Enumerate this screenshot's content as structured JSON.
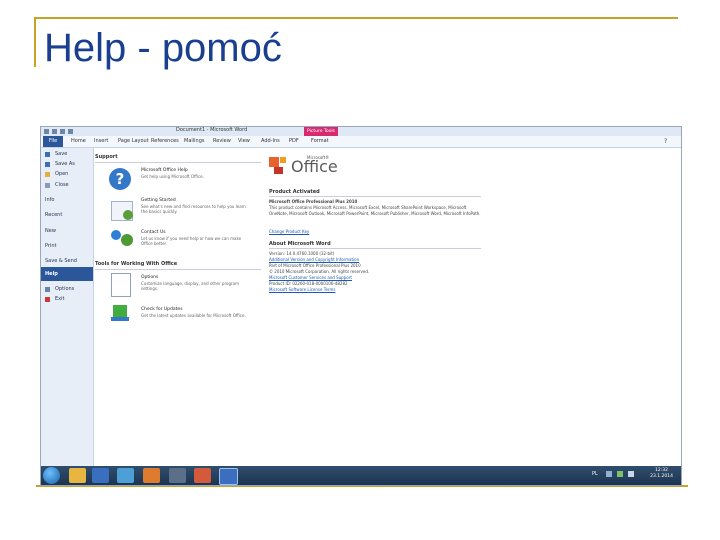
{
  "slide": {
    "title": "Help - pomoć"
  },
  "window": {
    "title": "Document1 - Microsoft Word",
    "context_tab": "Picture Tools",
    "controls": [
      "–",
      "□",
      "×"
    ]
  },
  "ribbon": {
    "tabs": [
      "File",
      "Home",
      "Insert",
      "Page Layout",
      "References",
      "Mailings",
      "Review",
      "View",
      "Add-Ins",
      "PDF",
      "Format"
    ]
  },
  "backstage": {
    "items": [
      "Save",
      "Save As",
      "Open",
      "Close",
      "Info",
      "Recent",
      "New",
      "Print",
      "Save & Send",
      "Help",
      "Options",
      "Exit"
    ],
    "selected": "Help"
  },
  "support": {
    "header": "Support",
    "items": [
      {
        "title": "Microsoft Office Help",
        "desc": "Get help using Microsoft Office."
      },
      {
        "title": "Getting Started",
        "desc": "See what's new and find resources to help you learn the basics quickly."
      },
      {
        "title": "Contact Us",
        "desc": "Let us know if you need help or how we can make Office better."
      }
    ]
  },
  "tools": {
    "header": "Tools for Working With Office",
    "items": [
      {
        "title": "Options",
        "desc": "Customize language, display, and other program settings."
      },
      {
        "title": "Check for Updates",
        "desc": "Get the latest updates available for Microsoft Office."
      }
    ]
  },
  "product": {
    "logo_ms": "Microsoft®",
    "logo_text": "Office",
    "activated_header": "Product Activated",
    "name": "Microsoft Office Professional Plus 2010",
    "contains": "This product contains Microsoft Access, Microsoft Excel, Microsoft SharePoint Workspace, Microsoft OneNote, Microsoft Outlook, Microsoft PowerPoint, Microsoft Publisher, Microsoft Word, Microsoft InfoPath.",
    "change_key": "Change Product Key",
    "about_header": "About Microsoft Word",
    "version": "Version: 14.0.4760.1000 (32-bit)",
    "additional": "Additional Version and Copyright Information",
    "part_of": "Part of Microsoft Office Professional Plus 2010",
    "copyright": "© 2010 Microsoft Corporation. All rights reserved.",
    "support_link": "Microsoft Customer Services and Support",
    "product_id": "Product ID: 02260-018-0000106-48282",
    "license": "Microsoft Software License Terms"
  },
  "taskbar": {
    "lang": "PL",
    "time": "12:32",
    "date": "23.1.2014"
  },
  "colors": {
    "title": "#1a3f8f",
    "gold": "#c8a32a",
    "file_tab": "#2b579a",
    "context": "#d62c6f",
    "office_orange": "#e8632b"
  }
}
